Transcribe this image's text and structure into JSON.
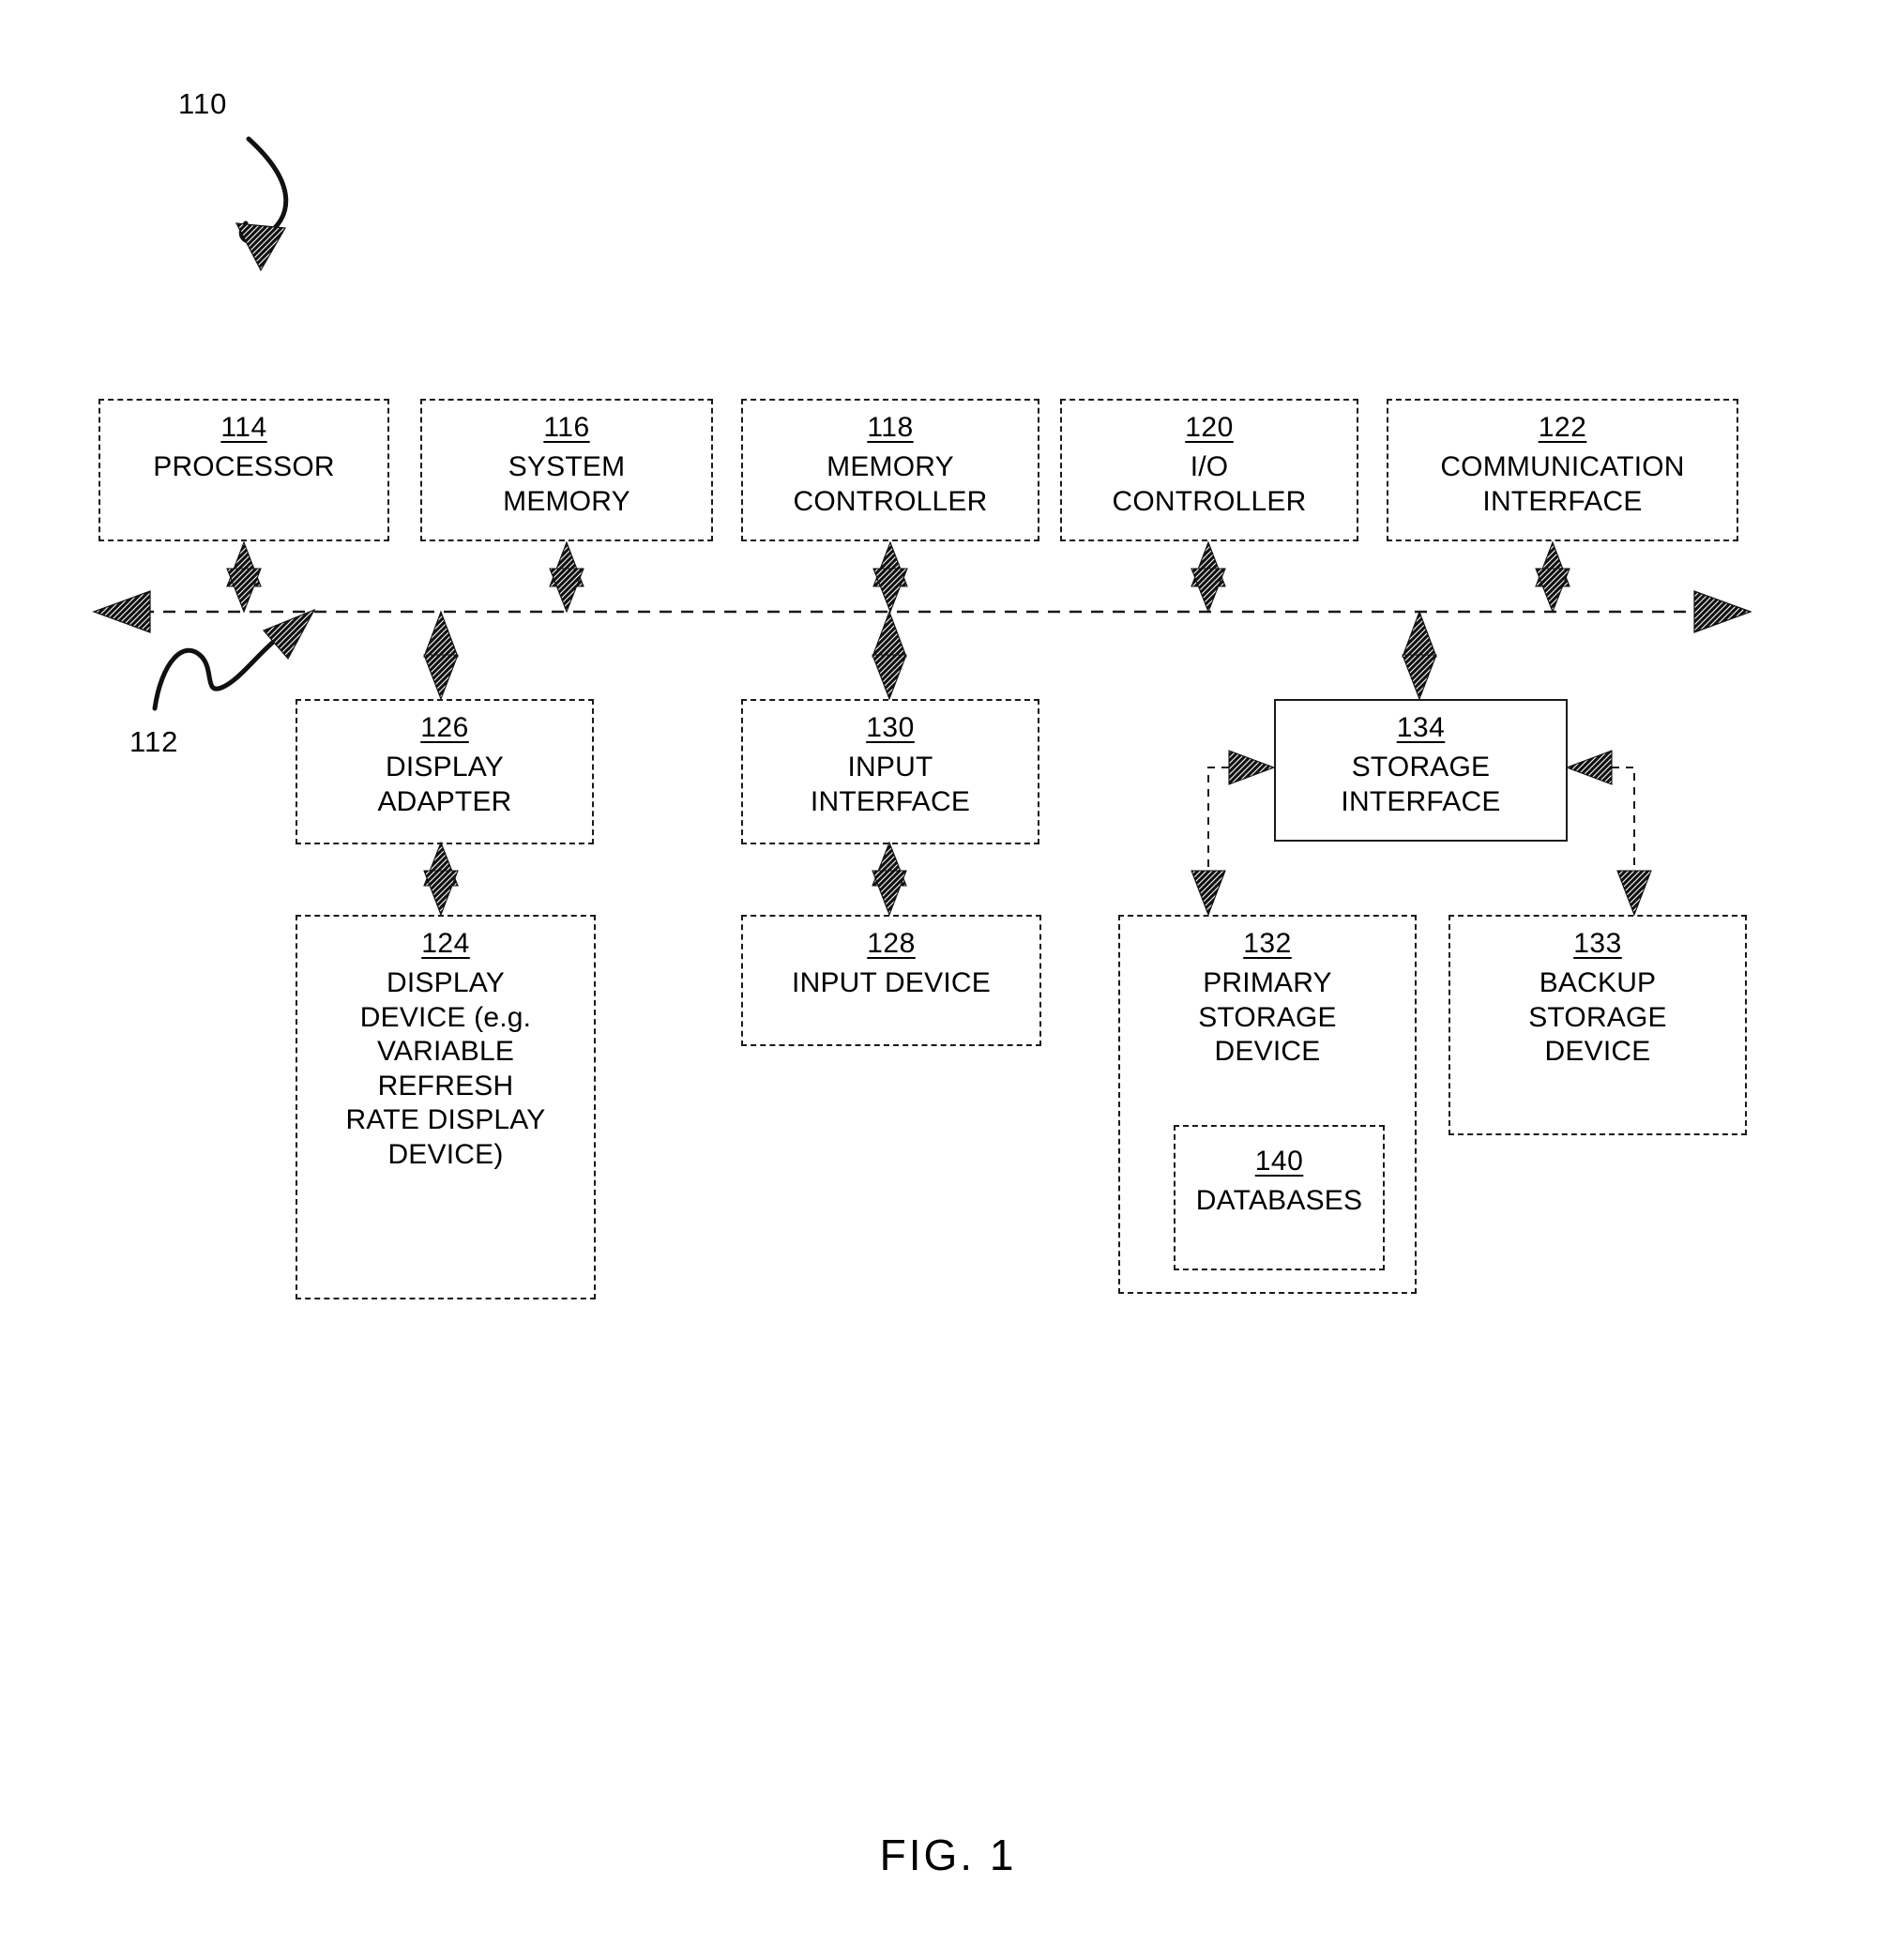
{
  "figure": {
    "caption": "FIG. 1",
    "system_ref": "110",
    "bus_ref": "112"
  },
  "nodes": {
    "processor": {
      "ref": "114",
      "label": "PROCESSOR"
    },
    "system_memory": {
      "ref": "116",
      "label": "SYSTEM\nMEMORY"
    },
    "memory_controller": {
      "ref": "118",
      "label": "MEMORY\nCONTROLLER"
    },
    "io_controller": {
      "ref": "120",
      "label": "I/O\nCONTROLLER"
    },
    "comm_interface": {
      "ref": "122",
      "label": "COMMUNICATION\nINTERFACE"
    },
    "display_adapter": {
      "ref": "126",
      "label": "DISPLAY\nADAPTER"
    },
    "display_device": {
      "ref": "124",
      "label": "DISPLAY\nDEVICE (e.g.\nVARIABLE\nREFRESH\nRATE DISPLAY\nDEVICE)"
    },
    "input_interface": {
      "ref": "130",
      "label": "INPUT\nINTERFACE"
    },
    "input_device": {
      "ref": "128",
      "label": "INPUT DEVICE"
    },
    "storage_interface": {
      "ref": "134",
      "label": "STORAGE\nINTERFACE"
    },
    "primary_storage": {
      "ref": "132",
      "label": "PRIMARY\nSTORAGE\nDEVICE"
    },
    "databases": {
      "ref": "140",
      "label": "DATABASES"
    },
    "backup_storage": {
      "ref": "133",
      "label": "BACKUP\nSTORAGE\nDEVICE"
    }
  },
  "connections": [
    {
      "from": "processor",
      "to": "bus",
      "type": "bidirectional"
    },
    {
      "from": "system_memory",
      "to": "bus",
      "type": "bidirectional"
    },
    {
      "from": "memory_controller",
      "to": "bus",
      "type": "bidirectional"
    },
    {
      "from": "io_controller",
      "to": "bus",
      "type": "bidirectional"
    },
    {
      "from": "comm_interface",
      "to": "bus",
      "type": "bidirectional"
    },
    {
      "from": "bus",
      "to": "display_adapter",
      "type": "bidirectional"
    },
    {
      "from": "bus",
      "to": "input_interface",
      "type": "bidirectional"
    },
    {
      "from": "bus",
      "to": "storage_interface",
      "type": "bidirectional"
    },
    {
      "from": "display_adapter",
      "to": "display_device",
      "type": "bidirectional"
    },
    {
      "from": "input_interface",
      "to": "input_device",
      "type": "bidirectional"
    },
    {
      "from": "storage_interface",
      "to": "primary_storage",
      "type": "bidirectional"
    },
    {
      "from": "storage_interface",
      "to": "backup_storage",
      "type": "bidirectional"
    }
  ],
  "colors": {
    "stroke": "#1a1a1a",
    "background": "#ffffff"
  }
}
